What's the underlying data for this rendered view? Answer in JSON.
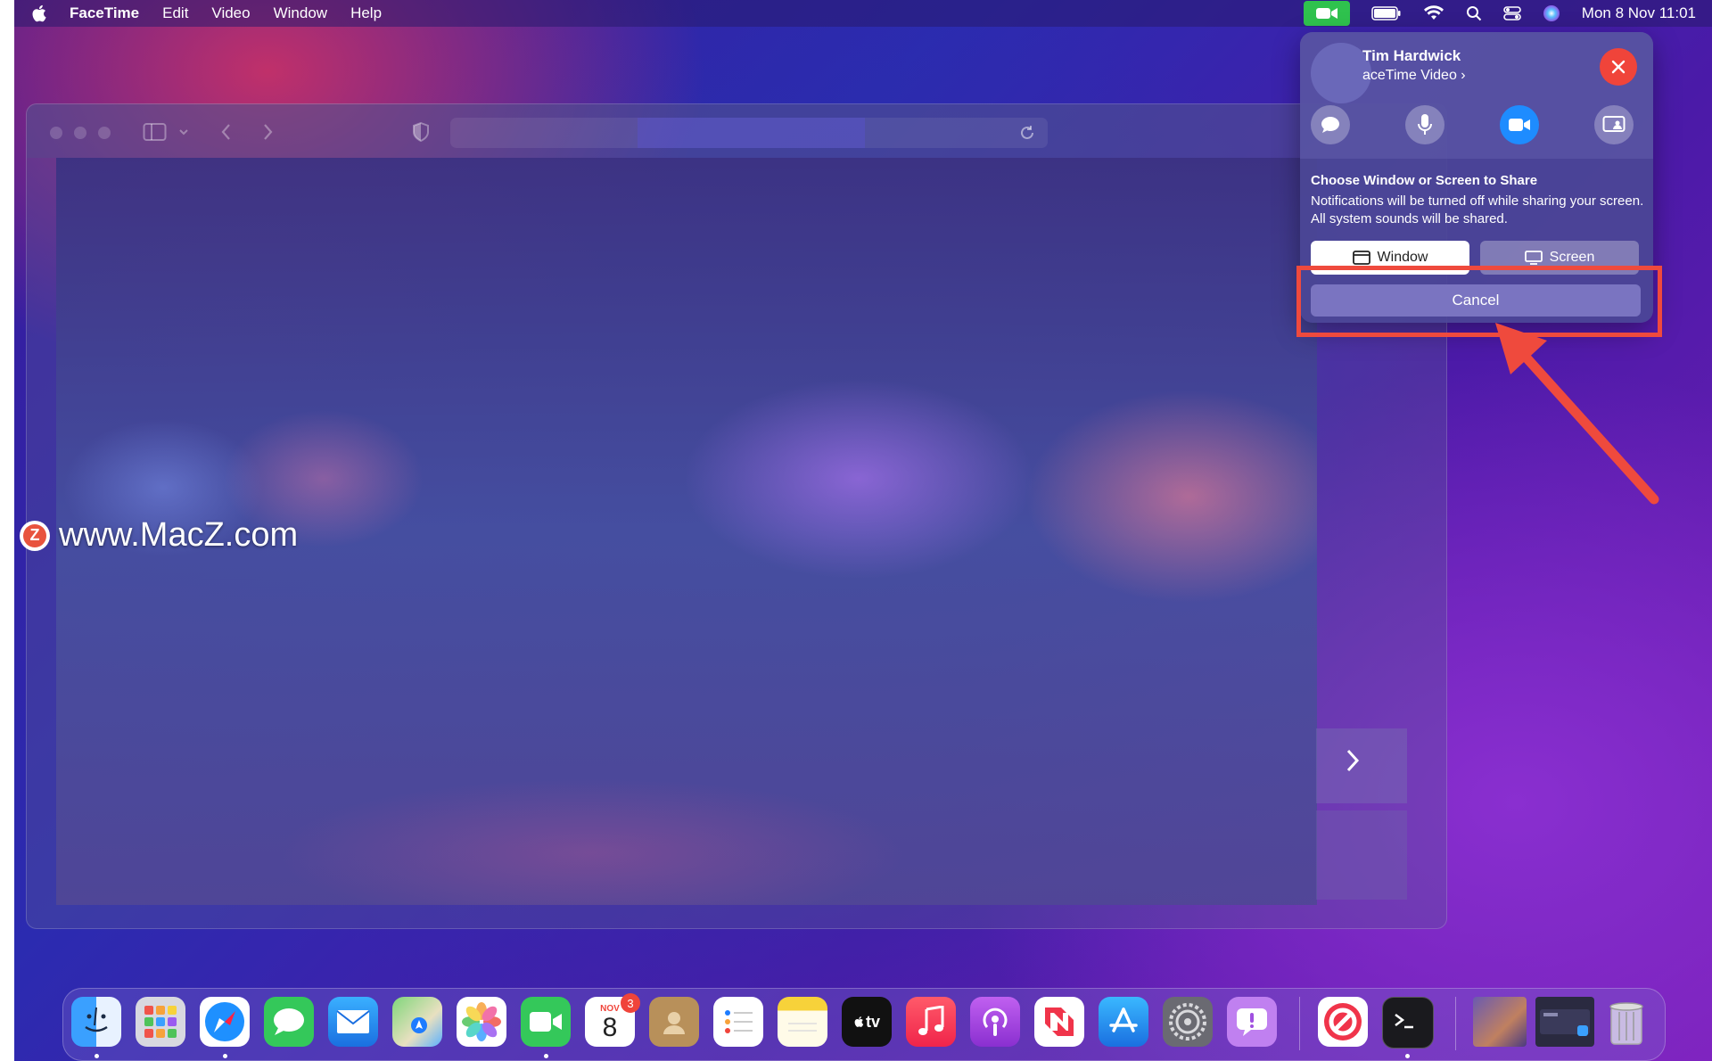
{
  "menubar": {
    "app_name": "FaceTime",
    "items": [
      "Edit",
      "Video",
      "Window",
      "Help"
    ],
    "datetime": "Mon 8 Nov  11:01"
  },
  "facetime": {
    "caller_name": "Tim Hardwick",
    "call_type": "aceTime Video",
    "share_title": "Choose Window or Screen to Share",
    "share_description": "Notifications will be turned off while sharing your screen. All system sounds will be shared.",
    "window_button": "Window",
    "screen_button": "Screen",
    "cancel_button": "Cancel"
  },
  "watermark": {
    "badge": "Z",
    "text": "www.MacZ.com"
  },
  "dock": {
    "calendar_month": "NOV",
    "calendar_day": "8",
    "calendar_badge": "3",
    "tv_label": "tv"
  },
  "colors": {
    "facetime_green": "#2fc24e",
    "close_red": "#f0443a",
    "annotation_red": "#ef4a3d",
    "video_active_blue": "#1e8cff"
  }
}
